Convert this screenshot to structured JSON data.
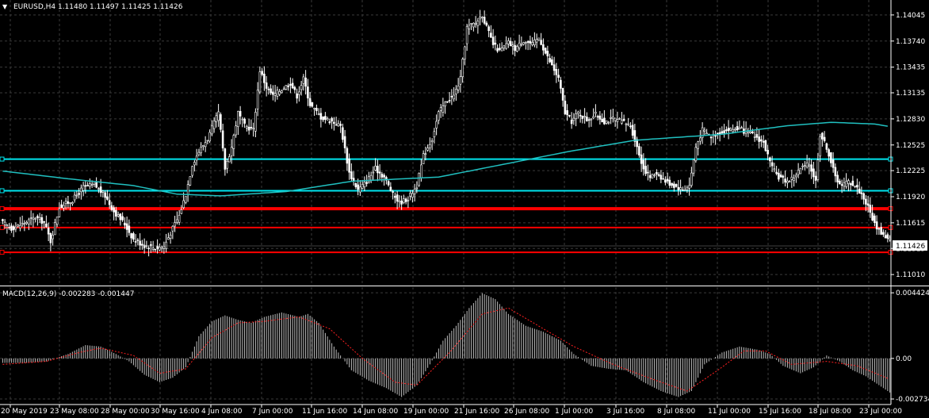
{
  "header": {
    "main_title": "EURUSD,H4  1.11480 1.11497 1.11425 1.11426",
    "macd_title": "MACD(12,26,9) -0.002283 -0.001447"
  },
  "colors": {
    "background": "#000000",
    "grid": "#3a3a3a",
    "candle": "#ffffff",
    "ma": "#20c0c0",
    "hline_cyan": "#00e5ee",
    "hline_red": "#ff0000",
    "macd_hist": "#c0c0c0",
    "macd_signal": "#ff2020",
    "price_tag_bg": "#ffffff",
    "price_tag_fg": "#000000"
  },
  "chart_data": [
    {
      "type": "candlestick",
      "symbol": "EURUSD",
      "timeframe": "H4",
      "last_price": "1.11426",
      "ylim": [
        1.109,
        1.1422
      ],
      "y_tick_labels": [
        "1.14045",
        "1.13740",
        "1.13435",
        "1.13135",
        "1.12830",
        "1.12525",
        "1.12225",
        "1.11920",
        "1.11615",
        "1.11315",
        "1.11010"
      ],
      "x_tick_labels": [
        "20 May 2019",
        "23 May 08:00",
        "28 May 00:00",
        "30 May 16:00",
        "4 Jun 08:00",
        "7 Jun 00:00",
        "11 Jun 16:00",
        "14 Jun 08:00",
        "19 Jun 00:00",
        "21 Jun 16:00",
        "26 Jun 08:00",
        "1 Jul 00:00",
        "3 Jul 16:00",
        "8 Jul 08:00",
        "11 Jul 00:00",
        "15 Jul 16:00",
        "18 Jul 08:00",
        "23 Jul 00:00"
      ],
      "horizontal_lines": [
        {
          "price": 1.1236,
          "color": "cyan",
          "width": 2
        },
        {
          "price": 1.1199,
          "color": "cyan",
          "width": 2
        },
        {
          "price": 1.1178,
          "color": "red",
          "width": 4
        },
        {
          "price": 1.1156,
          "color": "red",
          "width": 2
        },
        {
          "price": 1.1127,
          "color": "red",
          "width": 2
        }
      ],
      "close_path_keypoints": [
        [
          0,
          1.1163
        ],
        [
          5,
          1.1155
        ],
        [
          10,
          1.116
        ],
        [
          16,
          1.1168
        ],
        [
          20,
          1.1162
        ],
        [
          23,
          1.114
        ],
        [
          27,
          1.118
        ],
        [
          33,
          1.1188
        ],
        [
          38,
          1.1203
        ],
        [
          43,
          1.1206
        ],
        [
          48,
          1.1193
        ],
        [
          52,
          1.1175
        ],
        [
          57,
          1.116
        ],
        [
          61,
          1.1142
        ],
        [
          66,
          1.1135
        ],
        [
          71,
          1.1132
        ],
        [
          75,
          1.1134
        ],
        [
          78,
          1.115
        ],
        [
          82,
          1.117
        ],
        [
          85,
          1.1195
        ],
        [
          88,
          1.123
        ],
        [
          91,
          1.1245
        ],
        [
          95,
          1.126
        ],
        [
          100,
          1.129
        ],
        [
          103,
          1.1225
        ],
        [
          106,
          1.125
        ],
        [
          109,
          1.129
        ],
        [
          112,
          1.1275
        ],
        [
          116,
          1.127
        ],
        [
          119,
          1.134
        ],
        [
          122,
          1.132
        ],
        [
          125,
          1.131
        ],
        [
          129,
          1.1318
        ],
        [
          133,
          1.1325
        ],
        [
          136,
          1.131
        ],
        [
          139,
          1.133
        ],
        [
          142,
          1.13
        ],
        [
          147,
          1.1285
        ],
        [
          152,
          1.128
        ],
        [
          156,
          1.1275
        ],
        [
          160,
          1.122
        ],
        [
          164,
          1.12
        ],
        [
          168,
          1.121
        ],
        [
          172,
          1.1225
        ],
        [
          176,
          1.1215
        ],
        [
          180,
          1.1195
        ],
        [
          183,
          1.1185
        ],
        [
          187,
          1.119
        ],
        [
          191,
          1.1205
        ],
        [
          194,
          1.124
        ],
        [
          198,
          1.126
        ],
        [
          201,
          1.129
        ],
        [
          205,
          1.1305
        ],
        [
          208,
          1.131
        ],
        [
          211,
          1.133
        ],
        [
          214,
          1.139
        ],
        [
          218,
          1.1395
        ],
        [
          221,
          1.1405
        ],
        [
          223,
          1.139
        ],
        [
          226,
          1.137
        ],
        [
          229,
          1.1362
        ],
        [
          233,
          1.1372
        ],
        [
          236,
          1.1365
        ],
        [
          240,
          1.1375
        ],
        [
          244,
          1.137
        ],
        [
          247,
          1.1378
        ],
        [
          250,
          1.136
        ],
        [
          253,
          1.1345
        ],
        [
          256,
          1.133
        ],
        [
          259,
          1.129
        ],
        [
          262,
          1.128
        ],
        [
          265,
          1.129
        ],
        [
          269,
          1.1282
        ],
        [
          273,
          1.1288
        ],
        [
          277,
          1.128
        ],
        [
          281,
          1.1283
        ],
        [
          285,
          1.128
        ],
        [
          289,
          1.1275
        ],
        [
          292,
          1.125
        ],
        [
          295,
          1.1225
        ],
        [
          298,
          1.1215
        ],
        [
          301,
          1.122
        ],
        [
          305,
          1.121
        ],
        [
          309,
          1.1205
        ],
        [
          313,
          1.12
        ],
        [
          316,
          1.1205
        ],
        [
          319,
          1.125
        ],
        [
          322,
          1.127
        ],
        [
          326,
          1.1262
        ],
        [
          330,
          1.1268
        ],
        [
          334,
          1.127
        ],
        [
          338,
          1.1272
        ],
        [
          342,
          1.1268
        ],
        [
          346,
          1.1263
        ],
        [
          350,
          1.1255
        ],
        [
          354,
          1.1225
        ],
        [
          357,
          1.1215
        ],
        [
          361,
          1.121
        ],
        [
          364,
          1.1215
        ],
        [
          367,
          1.1225
        ],
        [
          371,
          1.123
        ],
        [
          374,
          1.121
        ],
        [
          376,
          1.1265
        ],
        [
          379,
          1.125
        ],
        [
          383,
          1.1215
        ],
        [
          386,
          1.1205
        ],
        [
          389,
          1.121
        ],
        [
          392,
          1.1205
        ],
        [
          395,
          1.1195
        ],
        [
          398,
          1.118
        ],
        [
          401,
          1.116
        ],
        [
          404,
          1.115
        ],
        [
          407,
          1.11426
        ]
      ],
      "ma_keypoints": [
        [
          0,
          1.1222
        ],
        [
          30,
          1.1213
        ],
        [
          60,
          1.1205
        ],
        [
          80,
          1.1195
        ],
        [
          100,
          1.1193
        ],
        [
          130,
          1.1198
        ],
        [
          160,
          1.121
        ],
        [
          200,
          1.1215
        ],
        [
          230,
          1.123
        ],
        [
          260,
          1.1245
        ],
        [
          290,
          1.1258
        ],
        [
          330,
          1.1265
        ],
        [
          360,
          1.1275
        ],
        [
          380,
          1.1279
        ],
        [
          400,
          1.1277
        ],
        [
          407,
          1.1274
        ]
      ]
    },
    {
      "type": "bar",
      "name": "MACD(12,26,9)",
      "main_value": "-0.002283",
      "signal_value": "-0.001447",
      "ylim": [
        -0.003,
        0.0047
      ],
      "y_tick_labels": [
        "0.004424",
        "0.00",
        "-0.002734"
      ],
      "macd_keypoints": [
        [
          0,
          -0.0003
        ],
        [
          10,
          -0.0003
        ],
        [
          20,
          -0.0002
        ],
        [
          30,
          0.0003
        ],
        [
          38,
          0.0009
        ],
        [
          45,
          0.0008
        ],
        [
          52,
          0.0003
        ],
        [
          58,
          -0.0002
        ],
        [
          65,
          -0.0011
        ],
        [
          72,
          -0.0016
        ],
        [
          78,
          -0.0013
        ],
        [
          84,
          -0.0006
        ],
        [
          90,
          0.0015
        ],
        [
          96,
          0.0025
        ],
        [
          102,
          0.0029
        ],
        [
          108,
          0.0026
        ],
        [
          114,
          0.0024
        ],
        [
          120,
          0.0028
        ],
        [
          128,
          0.0031
        ],
        [
          136,
          0.0028
        ],
        [
          140,
          0.003
        ],
        [
          145,
          0.0024
        ],
        [
          152,
          0.0008
        ],
        [
          160,
          -0.0008
        ],
        [
          168,
          -0.0015
        ],
        [
          176,
          -0.002
        ],
        [
          183,
          -0.0026
        ],
        [
          190,
          -0.0018
        ],
        [
          196,
          -0.0004
        ],
        [
          202,
          0.0012
        ],
        [
          208,
          0.0022
        ],
        [
          214,
          0.0034
        ],
        [
          220,
          0.0044
        ],
        [
          226,
          0.004
        ],
        [
          232,
          0.003
        ],
        [
          240,
          0.0022
        ],
        [
          248,
          0.0018
        ],
        [
          256,
          0.0012
        ],
        [
          262,
          0.0003
        ],
        [
          270,
          -0.0005
        ],
        [
          278,
          -0.0007
        ],
        [
          286,
          -0.0008
        ],
        [
          294,
          -0.0016
        ],
        [
          302,
          -0.0022
        ],
        [
          310,
          -0.0026
        ],
        [
          316,
          -0.0022
        ],
        [
          322,
          -0.0004
        ],
        [
          330,
          0.0004
        ],
        [
          338,
          0.0008
        ],
        [
          346,
          0.0006
        ],
        [
          352,
          0.0003
        ],
        [
          358,
          -0.0005
        ],
        [
          366,
          -0.001
        ],
        [
          372,
          -0.0006
        ],
        [
          378,
          0.0002
        ],
        [
          384,
          -0.0002
        ],
        [
          390,
          -0.0008
        ],
        [
          396,
          -0.0012
        ],
        [
          402,
          -0.0018
        ],
        [
          407,
          -0.0023
        ]
      ],
      "signal_keypoints": [
        [
          0,
          -0.0004
        ],
        [
          20,
          -0.0002
        ],
        [
          35,
          0.0004
        ],
        [
          45,
          0.0007
        ],
        [
          60,
          0.0002
        ],
        [
          72,
          -0.001
        ],
        [
          84,
          -0.0007
        ],
        [
          96,
          0.0014
        ],
        [
          108,
          0.0024
        ],
        [
          120,
          0.0025
        ],
        [
          136,
          0.0028
        ],
        [
          150,
          0.002
        ],
        [
          165,
          0.0
        ],
        [
          180,
          -0.0016
        ],
        [
          190,
          -0.0018
        ],
        [
          205,
          0.0004
        ],
        [
          220,
          0.003
        ],
        [
          232,
          0.0034
        ],
        [
          248,
          0.002
        ],
        [
          262,
          0.0008
        ],
        [
          280,
          -0.0004
        ],
        [
          300,
          -0.0015
        ],
        [
          314,
          -0.0022
        ],
        [
          328,
          -0.0008
        ],
        [
          340,
          0.0005
        ],
        [
          350,
          0.0005
        ],
        [
          362,
          -0.0004
        ],
        [
          378,
          -0.0002
        ],
        [
          392,
          -0.0005
        ],
        [
          407,
          -0.0014
        ]
      ]
    }
  ]
}
